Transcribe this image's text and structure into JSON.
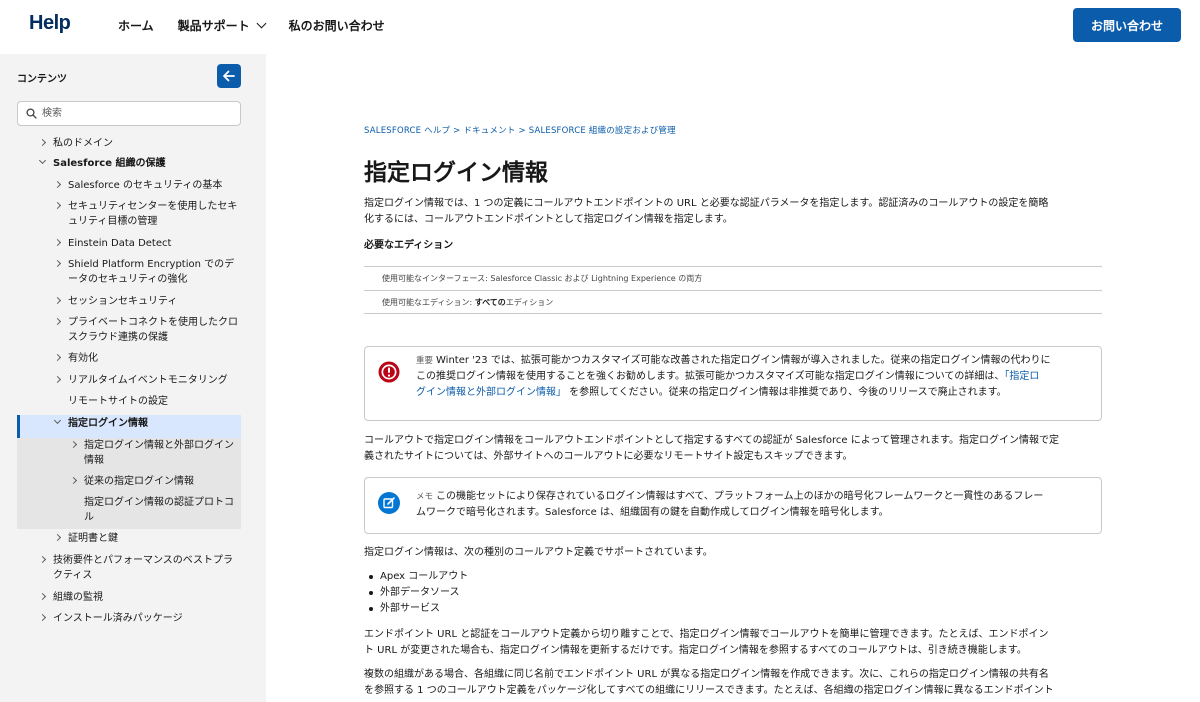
{
  "header": {
    "logo": "Help",
    "nav": [
      "ホーム",
      "製品サポート",
      "私のお問い合わせ"
    ],
    "contact_button": "お問い合わせ"
  },
  "sidebar": {
    "title": "コンテンツ",
    "search_placeholder": "検索",
    "items": [
      {
        "label": "私のドメイン",
        "arrow": "right"
      },
      {
        "label": "Salesforce 組織の保護",
        "arrow": "down"
      },
      {
        "label": "Salesforce のセキュリティの基本",
        "arrow": "right"
      },
      {
        "label": "セキュリティセンターを使用したセキュリティ目標の管理",
        "line1": "セキュリティセンターを使用したセキ",
        "line2": "ュリティ目標の管理",
        "arrow": "right"
      },
      {
        "label": "Einstein Data Detect",
        "arrow": "right"
      },
      {
        "label": "Shield Platform Encryption でのデータのセキュリティの強化",
        "line1": "Shield Platform Encryption でのデ",
        "line2": "ータのセキュリティの強化",
        "arrow": "right"
      },
      {
        "label": "セッションセキュリティ",
        "arrow": "right"
      },
      {
        "label": "プライベートコネクトを使用したクロスクラウド連携の保護",
        "line1": "プライベートコネクトを使用したクロ",
        "line2": "スクラウド連携の保護",
        "arrow": "right"
      },
      {
        "label": "有効化",
        "arrow": "right"
      },
      {
        "label": "リアルタイムイベントモニタリング",
        "arrow": "right"
      },
      {
        "label": "リモートサイトの設定",
        "arrow": "none"
      },
      {
        "label": "指定ログイン情報",
        "arrow": "down",
        "selected": true
      },
      {
        "label": "指定ログイン情報と外部ログイン情報",
        "line1": "指定ログイン情報と外部ログイン",
        "line2": "情報",
        "arrow": "right"
      },
      {
        "label": "従来の指定ログイン情報",
        "arrow": "right"
      },
      {
        "label": "指定ログイン情報の認証プロトコル",
        "line1": "指定ログイン情報の認証プロトコ",
        "line2": "ル",
        "arrow": "none"
      },
      {
        "label": "証明書と鍵",
        "arrow": "right"
      },
      {
        "label": "技術要件とパフォーマンスのベストプラクティス",
        "line1": "技術要件とパフォーマンスのベストプラ",
        "line2": "クティス",
        "arrow": "right"
      },
      {
        "label": "組織の監視",
        "arrow": "right"
      },
      {
        "label": "インストール済みパッケージ",
        "arrow": "right"
      }
    ]
  },
  "main": {
    "breadcrumb": "SALESFORCE ヘルプ > ドキュメント > SALESFORCE 組織の設定および管理",
    "title": "指定ログイン情報",
    "intro_line1": "指定ログイン情報では、1 つの定義にコールアウトエンドポイントの URL と必要な認証パラメータを指定します。認証済みのコールアウトの設定を簡略",
    "intro_line2": "化するには、コールアウトエンドポイントとして指定ログイン情報を指定します。",
    "edition_heading": "必要なエディション",
    "edition_row1_label": "使用可能なインターフェース: ",
    "edition_row1_value": "Salesforce Classic および Lightning Experience の両方",
    "edition_row2_label": "使用可能なエディション: ",
    "edition_row2_bold": "すべての",
    "edition_row2_value": "エディション",
    "important": {
      "tag": "重要",
      "line1": "Winter '23 では、拡張可能かつカスタマイズ可能な改善された指定ログイン情報が導入されました。従来の指定ログイン情報の代わりに",
      "line2a": "この推奨ログイン情報を使用することを強くお勧めします。拡張可能かつカスタマイズ可能な指定ログイン情報についての詳細は、",
      "link1": "「指定ロ",
      "link2": "グイン情報と外部ログイン情報」",
      "line3b": " を参照してください。従来の指定ログイン情報は非推奨であり、今後のリリースで廃止されます。"
    },
    "para2_line1": "コールアウトで指定ログイン情報をコールアウトエンドポイントとして指定するすべての認証が Salesforce によって管理されます。指定ログイン情報で定",
    "para2_line2": "義されたサイトについては、外部サイトへのコールアウトに必要なリモートサイト設定もスキップできます。",
    "memo": {
      "tag": "メモ",
      "line1": "この機能セットにより保存されているログイン情報はすべて、プラットフォーム上のほかの暗号化フレームワークと一貫性のあるフレー",
      "line2": "ムワークで暗号化されます。Salesforce は、組織固有の鍵を自動作成してログイン情報を暗号化します。"
    },
    "para3": "指定ログイン情報は、次の種別のコールアウト定義でサポートされています。",
    "bullets": [
      "Apex コールアウト",
      "外部データソース",
      "外部サービス"
    ],
    "para4_line1": "エンドポイント URL と認証をコールアウト定義から切り離すことで、指定ログイン情報でコールアウトを簡単に管理できます。たとえば、エンドポイン",
    "para4_line2": "ト URL が変更された場合も、指定ログイン情報を更新するだけです。指定ログイン情報を参照するすべてのコールアウトは、引き続き機能します。",
    "para5_line1": "複数の組織がある場合、各組織に同じ名前でエンドポイント URL が異なる指定ログイン情報を作成できます。次に、これらの指定ログイン情報の共有名",
    "para5_line2": "を参照する 1 つのコールアウト定義をパッケージ化してすべての組織にリリースできます。たとえば、各組織の指定ログイン情報に異なるエンドポイント"
  },
  "colors": {
    "brand": "#0b5cab",
    "logo": "#032d60",
    "error": "#ba0517",
    "info": "#0176d3",
    "sidebar_bg": "#f3f3f3"
  }
}
